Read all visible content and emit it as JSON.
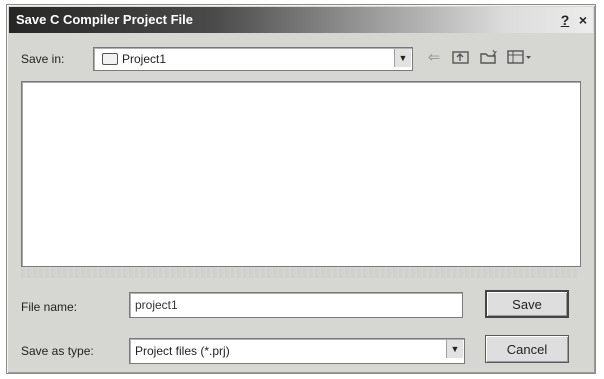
{
  "window": {
    "title": "Save C Compiler Project File",
    "help_label": "?",
    "close_label": "×"
  },
  "toolbar": {
    "save_in_label": "Save in:",
    "save_in_value": "Project1",
    "icons": [
      "back-arrow-icon",
      "up-folder-icon",
      "new-folder-icon",
      "view-menu-icon"
    ]
  },
  "file_list": {
    "items": []
  },
  "form": {
    "file_name_label": "File name:",
    "file_name_value": "project1",
    "save_as_type_label": "Save as type:",
    "save_as_type_value": "Project files (*.prj)"
  },
  "buttons": {
    "save_label": "Save",
    "cancel_label": "Cancel"
  }
}
